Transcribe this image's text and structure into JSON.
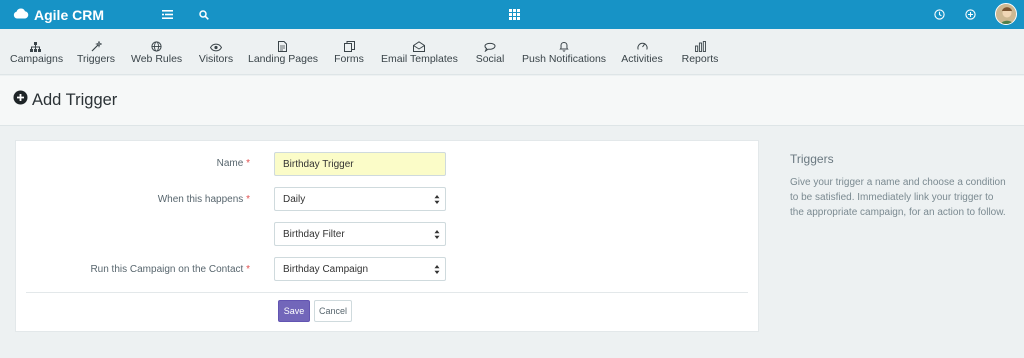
{
  "app": {
    "brand": "Agile CRM",
    "accent_color": "#1793c6",
    "icons": [
      "cloud-icon",
      "menu-icon",
      "search-icon",
      "grid-icon",
      "clock-icon",
      "add-circle-icon",
      "avatar"
    ]
  },
  "nav": {
    "items": [
      {
        "label": "Campaigns",
        "icon": "sitemap-icon"
      },
      {
        "label": "Triggers",
        "icon": "wand-icon"
      },
      {
        "label": "Web Rules",
        "icon": "globe-icon"
      },
      {
        "label": "Visitors",
        "icon": "eye-icon"
      },
      {
        "label": "Landing Pages",
        "icon": "file-icon"
      },
      {
        "label": "Forms",
        "icon": "forms-icon"
      },
      {
        "label": "Email Templates",
        "icon": "envelope-icon"
      },
      {
        "label": "Social",
        "icon": "chat-icon"
      },
      {
        "label": "Push Notifications",
        "icon": "bell-icon"
      },
      {
        "label": "Activities",
        "icon": "gauge-icon"
      },
      {
        "label": "Reports",
        "icon": "bar-chart-icon"
      }
    ]
  },
  "page": {
    "title": "Add Trigger"
  },
  "form": {
    "name_label": "Name",
    "name_value": "Birthday Trigger",
    "when_label": "When this happens",
    "when_value": "Daily",
    "filter_value": "Birthday Filter",
    "campaign_label": "Run this Campaign on the Contact",
    "campaign_value": "Birthday Campaign",
    "required_mark": "*",
    "save_label": "Save",
    "cancel_label": "Cancel",
    "save_color": "#7266ba"
  },
  "help": {
    "title": "Triggers",
    "text": "Give your trigger a name and choose a condition to be satisfied. Immediately link your trigger to the appropriate campaign, for an action to follow."
  }
}
